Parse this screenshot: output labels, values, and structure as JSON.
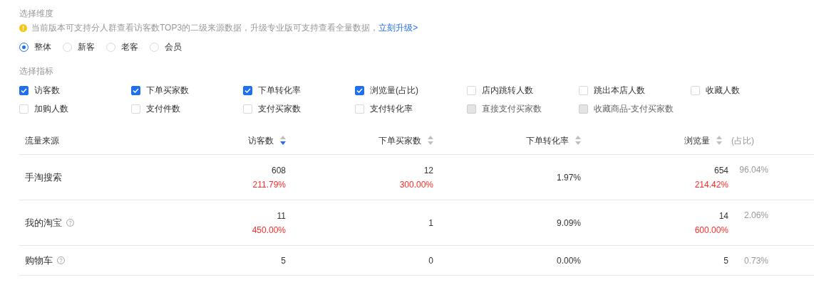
{
  "dimension": {
    "title": "选择维度",
    "notice": "当前版本可支持分人群查看访客数TOP3的二级来源数据，升级专业版可支持查看全量数据，",
    "notice_link": "立刻升级>",
    "options": [
      {
        "label": "整体",
        "selected": true
      },
      {
        "label": "新客",
        "selected": false
      },
      {
        "label": "老客",
        "selected": false
      },
      {
        "label": "会员",
        "selected": false
      }
    ]
  },
  "metrics": {
    "title": "选择指标",
    "items": [
      {
        "label": "访客数",
        "checked": true,
        "disabled": false
      },
      {
        "label": "下单买家数",
        "checked": true,
        "disabled": false
      },
      {
        "label": "下单转化率",
        "checked": true,
        "disabled": false
      },
      {
        "label": "浏览量(占比)",
        "checked": true,
        "disabled": false
      },
      {
        "label": "店内跳转人数",
        "checked": false,
        "disabled": false
      },
      {
        "label": "跳出本店人数",
        "checked": false,
        "disabled": false
      },
      {
        "label": "收藏人数",
        "checked": false,
        "disabled": false
      },
      {
        "label": "加购人数",
        "checked": false,
        "disabled": false
      },
      {
        "label": "支付件数",
        "checked": false,
        "disabled": false
      },
      {
        "label": "支付买家数",
        "checked": false,
        "disabled": false
      },
      {
        "label": "支付转化率",
        "checked": false,
        "disabled": false
      },
      {
        "label": "直接支付买家数",
        "checked": false,
        "disabled": true
      },
      {
        "label": "收藏商品-支付买家数",
        "checked": false,
        "disabled": true
      }
    ]
  },
  "table": {
    "columns": [
      {
        "label": "流量来源"
      },
      {
        "label": "访客数",
        "sort_desc_active": true
      },
      {
        "label": "下单买家数",
        "sort_desc_active": false
      },
      {
        "label": "下单转化率",
        "sort_desc_active": false
      },
      {
        "label": "浏览量",
        "sort_desc_active": false,
        "suffix": "(占比)"
      }
    ],
    "rows": [
      {
        "source": "手淘搜索",
        "help": false,
        "visitors": "608",
        "visitors_change": "211.79%",
        "buyers": "12",
        "buyers_change": "300.00%",
        "rate": "1.97%",
        "views": "654",
        "views_change": "214.42%",
        "share": "96.04%"
      },
      {
        "source": "我的淘宝",
        "help": true,
        "visitors": "11",
        "visitors_change": "450.00%",
        "buyers": "1",
        "rate": "9.09%",
        "views": "14",
        "views_change": "600.00%",
        "share": "2.06%"
      },
      {
        "source": "购物车",
        "help": true,
        "visitors": "5",
        "buyers": "0",
        "rate": "0.00%",
        "views": "5",
        "share": "0.73%"
      }
    ]
  }
}
